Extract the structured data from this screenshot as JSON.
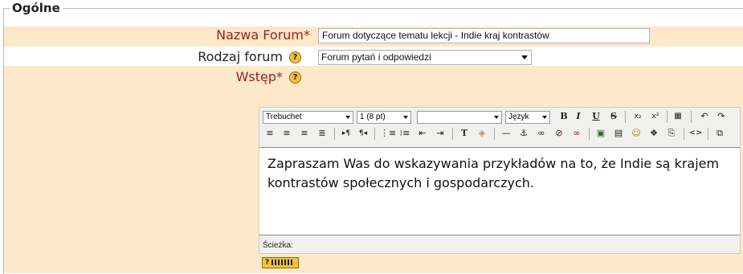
{
  "legend": "Ogólne",
  "fields": {
    "name": {
      "label": "Nazwa Forum*",
      "value": "Forum dotyczące tematu lekcji - Indie kraj kontrastów"
    },
    "type": {
      "label": "Rodzaj forum",
      "value": "Forum pytań i odpowiedzi"
    },
    "intro": {
      "label": "Wstęp*"
    }
  },
  "editor": {
    "font_family": "Trebuchet",
    "font_size": "1 (8 pt)",
    "format": "",
    "language": "Język",
    "content_line1": "Zapraszam Was do wskazywania przykładów na to, że Indie są krajem",
    "content_line2": "kontrastów społecznych i gospodarczych.",
    "path_label": "Ścieżka:"
  },
  "help_glyph": "?",
  "keyboard_glyph": "?"
}
